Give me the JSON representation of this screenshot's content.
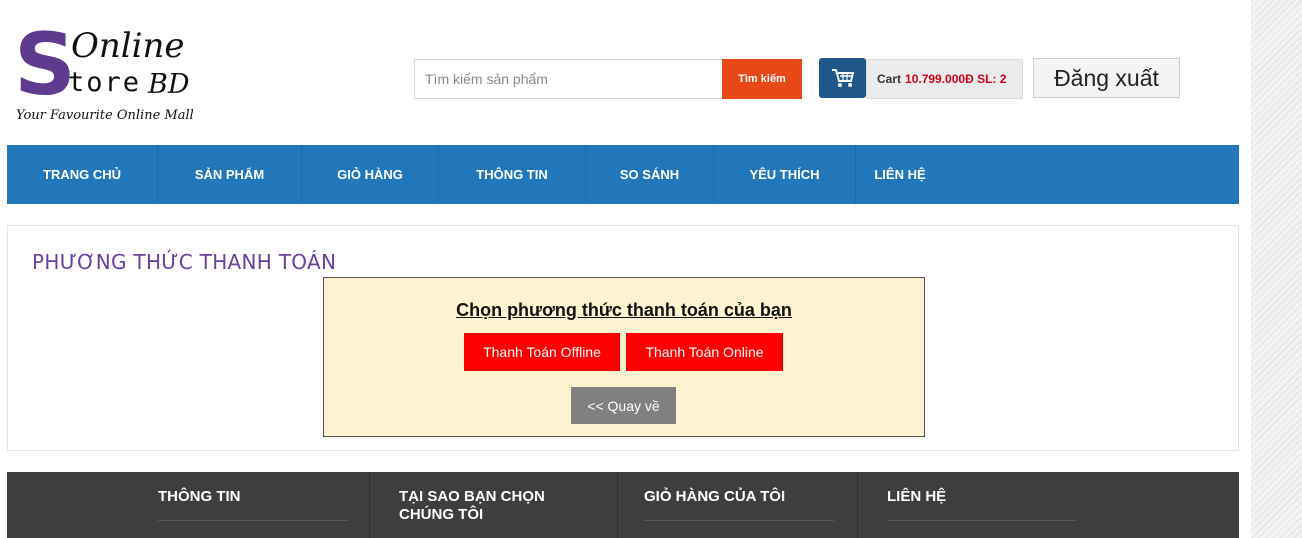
{
  "logo": {
    "letter": "S",
    "line1": "Online",
    "line2": "tore",
    "line2_suffix": "BD",
    "tagline": "Your Favourite Online Mall"
  },
  "search": {
    "placeholder": "Tìm kiếm sản phẩm",
    "value": "",
    "button_label": "Tìm kiếm"
  },
  "cart": {
    "icon": "shopping-cart-icon",
    "label": "Cart",
    "value": "10.799.000Đ SL: 2"
  },
  "account": {
    "logout_label": "Đăng xuất"
  },
  "nav": {
    "items": [
      {
        "label": "TRANG CHỦ"
      },
      {
        "label": "SẢN PHẨM"
      },
      {
        "label": "GIỎ HÀNG"
      },
      {
        "label": "THÔNG TIN"
      },
      {
        "label": "SO SÁNH"
      },
      {
        "label": "YÊU THÍCH"
      },
      {
        "label": "LIÊN HỆ"
      }
    ]
  },
  "main": {
    "title": "PHƯƠNG THỨC THANH TOÁN",
    "panel": {
      "heading": "Chọn phương thức thanh toán của bạn",
      "offline_label": "Thanh Toán Offline",
      "online_label": "Thanh Toán Online",
      "back_label": "<< Quay về"
    }
  },
  "footer": {
    "columns": [
      {
        "title": "THÔNG TIN"
      },
      {
        "title": "TẠI SAO BẠN CHỌN CHÚNG TÔI"
      },
      {
        "title": "GIỎ HÀNG CỦA TÔI"
      },
      {
        "title": "LIÊN HỆ"
      }
    ]
  },
  "colors": {
    "brand_purple": "#5e3b8f",
    "nav_blue": "#2277ba",
    "search_button": "#e84816",
    "cart_icon_bg": "#1f5888",
    "cart_value": "#d0021b",
    "pay_button": "#ff0000",
    "back_button": "#808080",
    "panel_bg": "#fef2d0",
    "footer_bg": "#3e3e3e"
  }
}
